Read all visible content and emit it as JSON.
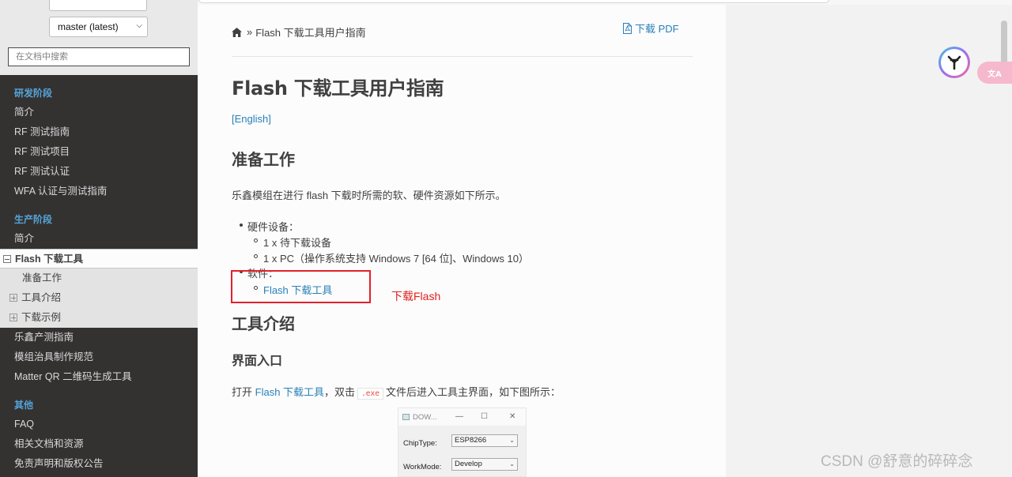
{
  "sidebar": {
    "version_select": "master (latest)",
    "search_placeholder": "在文档中搜索",
    "sections": {
      "dev_caption": "研发阶段",
      "dev_items": [
        "简介",
        "RF 测试指南",
        "RF 测试项目",
        "RF 测试认证",
        "WFA 认证与测试指南"
      ],
      "prod_caption": "生产阶段",
      "prod_intro": "简介",
      "current": "Flash 下载工具",
      "sub_items": [
        "准备工作",
        "工具介绍",
        "下载示例"
      ],
      "prod_rest": [
        "乐鑫产测指南",
        "模组治具制作规范",
        "Matter QR 二维码生成工具"
      ],
      "other_caption": "其他",
      "other_items": [
        "FAQ",
        "相关文档和资源",
        "免责声明和版权公告"
      ]
    }
  },
  "content": {
    "breadcrumb_sep": "»",
    "breadcrumb_page": "Flash 下载工具用户指南",
    "pdf_label": "下载 PDF",
    "title": "Flash 下载工具用户指南",
    "english_link": "[English]",
    "prep_heading": "准备工作",
    "prep_text": "乐鑫模组在进行 flash 下载时所需的软、硬件资源如下所示。",
    "hardware_label": "硬件设备：",
    "hardware_items": [
      "1 x 待下载设备",
      "1 x PC（操作系统支持 Windows 7 [64 位]、Windows 10）"
    ],
    "software_label": "软件：",
    "software_link": "Flash 下载工具",
    "annotation": "下载Flash",
    "tool_heading": "工具介绍",
    "entry_heading": "界面入口",
    "entry_text_prefix": "打开",
    "entry_link": "Flash 下载工具",
    "entry_text_mid": "，双击",
    "entry_code": ".exe",
    "entry_text_suffix": "文件后进入工具主界面，如下图所示："
  },
  "tool_window": {
    "title": "DOW...",
    "minimize": "—",
    "maximize": "☐",
    "close": "✕",
    "chip_label": "ChipType:",
    "chip_value": "ESP8266",
    "mode_label": "WorkMode:",
    "mode_value": "Develop"
  },
  "overlay": {
    "translate_label": "文A",
    "watermark": "CSDN @舒意的碎碎念"
  },
  "colors": {
    "sidebar_bg": "#343131",
    "caption": "#55a5d9",
    "link": "#2980b9",
    "annotation_red": "#e0212b"
  }
}
